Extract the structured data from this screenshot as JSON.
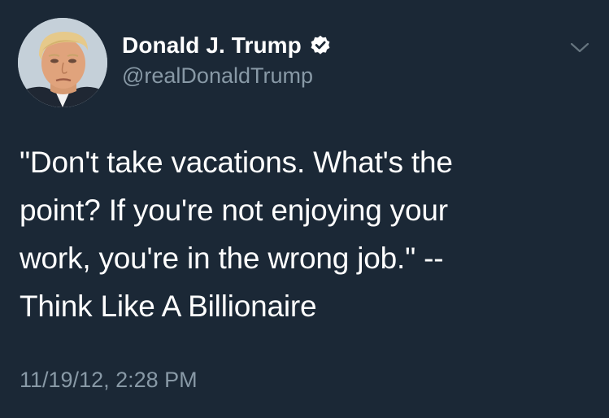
{
  "tweet": {
    "author": {
      "display_name": "Donald J. Trump",
      "handle": "@realDonaldTrump",
      "verified": true,
      "avatar_icon": "profile-photo"
    },
    "text": "\"Don't take vacations.  What's the\npoint?  If you're not enjoying your\nwork, you're in the wrong job.\"  --\nThink Like A Billionaire",
    "timestamp": "11/19/12, 2:28 PM",
    "menu_icon": "chevron-down-icon"
  },
  "colors": {
    "background": "#1b2836",
    "primary_text": "#ffffff",
    "secondary_text": "#8899a6",
    "verified_badge": "#ffffff"
  }
}
